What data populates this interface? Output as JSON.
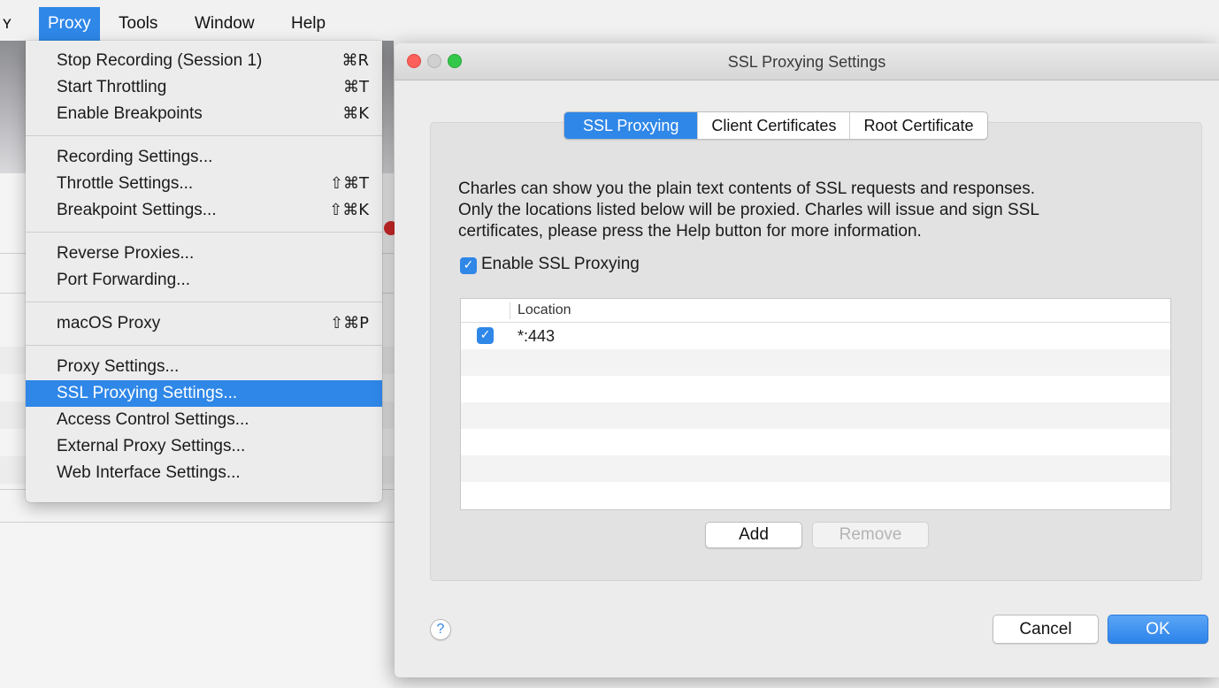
{
  "menubar": {
    "items": [
      {
        "label": "Proxy",
        "active": true
      },
      {
        "label": "Tools"
      },
      {
        "label": "Window"
      },
      {
        "label": "Help"
      }
    ]
  },
  "proxy_menu": {
    "groups": [
      [
        {
          "label": "Stop Recording (Session 1)",
          "shortcut": "⌘R"
        },
        {
          "label": "Start Throttling",
          "shortcut": "⌘T"
        },
        {
          "label": "Enable Breakpoints",
          "shortcut": "⌘K"
        }
      ],
      [
        {
          "label": "Recording Settings..."
        },
        {
          "label": "Throttle Settings...",
          "shortcut": "⇧⌘T"
        },
        {
          "label": "Breakpoint Settings...",
          "shortcut": "⇧⌘K"
        }
      ],
      [
        {
          "label": "Reverse Proxies..."
        },
        {
          "label": "Port Forwarding..."
        }
      ],
      [
        {
          "label": "macOS Proxy",
          "shortcut": "⇧⌘P"
        }
      ],
      [
        {
          "label": "Proxy Settings..."
        },
        {
          "label": "SSL Proxying Settings...",
          "highlighted": true
        },
        {
          "label": "Access Control Settings..."
        },
        {
          "label": "External Proxy Settings..."
        },
        {
          "label": "Web Interface Settings..."
        }
      ]
    ]
  },
  "dialog": {
    "title": "SSL Proxying Settings",
    "tabs": [
      {
        "label": "SSL Proxying",
        "selected": true
      },
      {
        "label": "Client Certificates"
      },
      {
        "label": "Root Certificate"
      }
    ],
    "description": [
      "Charles can show you the plain text contents of SSL requests and responses.",
      "Only the locations listed below will be proxied. Charles will issue and sign SSL",
      "certificates, please press the Help button for more information."
    ],
    "enable_ssl_label": "Enable SSL Proxying",
    "enable_ssl_checked": true,
    "table": {
      "column": "Location",
      "rows": [
        {
          "enabled": true,
          "location": "*:443"
        }
      ]
    },
    "add_label": "Add",
    "remove_label": "Remove",
    "help_label": "?",
    "cancel_label": "Cancel",
    "ok_label": "OK"
  },
  "colors": {
    "accent": "#2f87e8",
    "close": "#fc605b",
    "zoom": "#34c84a"
  }
}
